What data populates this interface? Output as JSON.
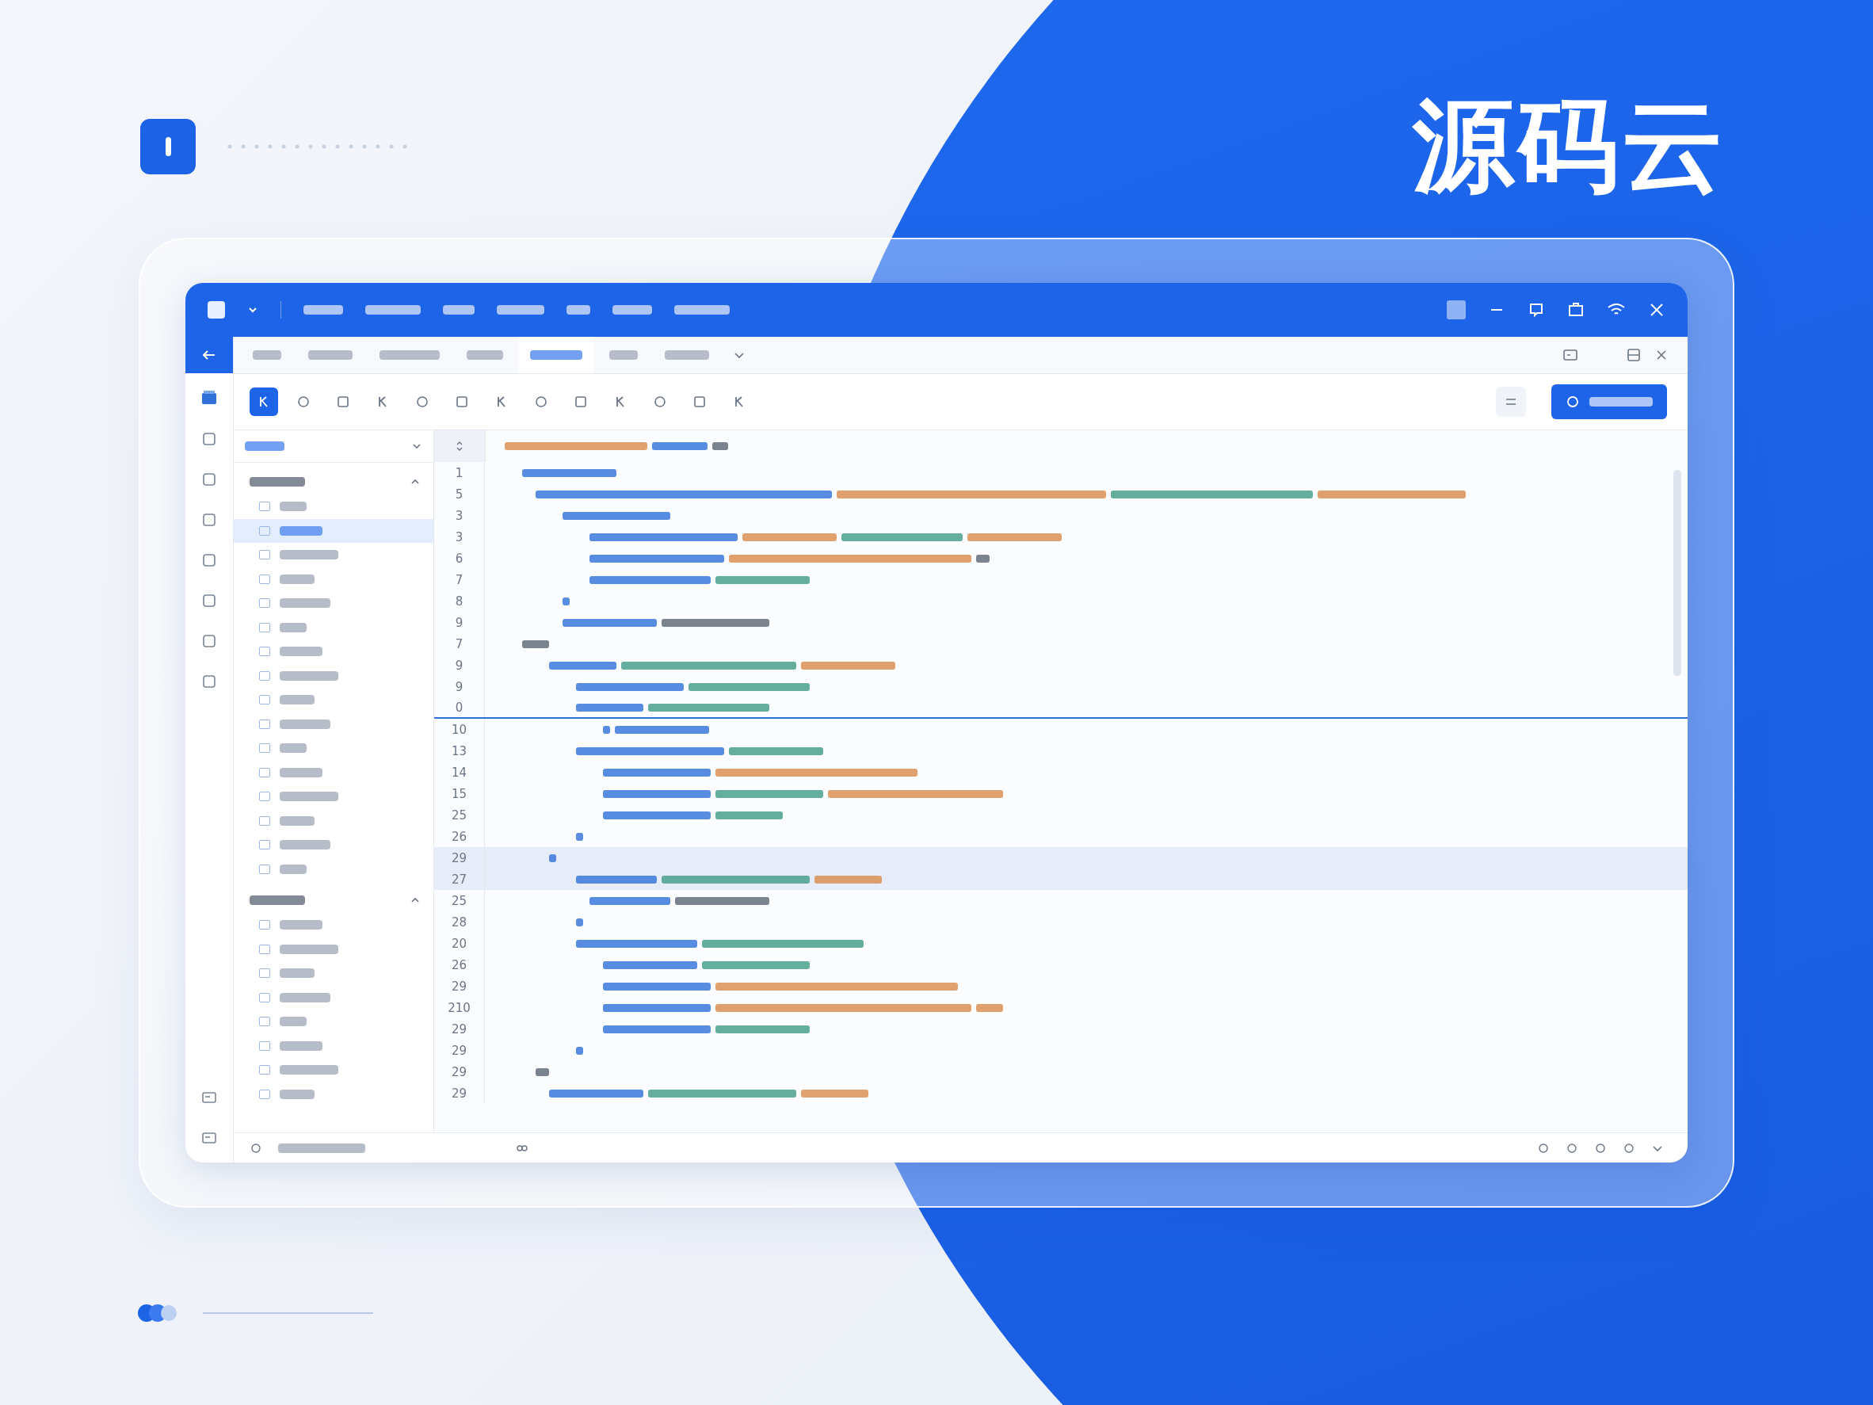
{
  "brand": {
    "title": "源码云"
  },
  "tabs": [
    {
      "selected": false
    },
    {
      "selected": false
    },
    {
      "selected": false
    },
    {
      "selected": false
    },
    {
      "selected": true
    },
    {
      "selected": false
    },
    {
      "selected": false
    }
  ],
  "toolbar": {
    "tools": [
      {
        "selected": true
      },
      {
        "selected": false
      },
      {
        "selected": false
      },
      {
        "selected": false
      },
      {
        "selected": false
      },
      {
        "selected": false
      },
      {
        "selected": false
      },
      {
        "selected": false
      },
      {
        "selected": false
      },
      {
        "selected": false
      },
      {
        "selected": false
      },
      {
        "selected": false
      },
      {
        "selected": false
      }
    ]
  },
  "tree": {
    "sections": [
      {
        "expanded": true,
        "children": [
          {
            "selected": false
          },
          {
            "selected": true
          },
          {
            "selected": false
          },
          {
            "selected": false
          },
          {
            "selected": false
          },
          {
            "selected": false
          },
          {
            "selected": false
          },
          {
            "selected": false
          },
          {
            "selected": false
          },
          {
            "selected": false
          },
          {
            "selected": false
          },
          {
            "selected": false
          },
          {
            "selected": false
          },
          {
            "selected": false
          },
          {
            "selected": false
          },
          {
            "selected": false
          }
        ]
      },
      {
        "expanded": true,
        "children": [
          {
            "selected": false
          },
          {
            "selected": false
          },
          {
            "selected": false
          },
          {
            "selected": false
          },
          {
            "selected": false
          },
          {
            "selected": false
          },
          {
            "selected": false
          },
          {
            "selected": false
          }
        ]
      }
    ]
  },
  "editor": {
    "lines": [
      {
        "number": "1",
        "highlighted": false,
        "current": false
      },
      {
        "number": "5",
        "highlighted": false,
        "current": false
      },
      {
        "number": "3",
        "highlighted": false,
        "current": false
      },
      {
        "number": "3",
        "highlighted": false,
        "current": false
      },
      {
        "number": "6",
        "highlighted": false,
        "current": false
      },
      {
        "number": "7",
        "highlighted": false,
        "current": false
      },
      {
        "number": "8",
        "highlighted": false,
        "current": false
      },
      {
        "number": "9",
        "highlighted": false,
        "current": false
      },
      {
        "number": "7",
        "highlighted": false,
        "current": false
      },
      {
        "number": "9",
        "highlighted": false,
        "current": false
      },
      {
        "number": "9",
        "highlighted": false,
        "current": false
      },
      {
        "number": "0",
        "highlighted": false,
        "current": true
      },
      {
        "number": "10",
        "highlighted": false,
        "current": false
      },
      {
        "number": "13",
        "highlighted": false,
        "current": false
      },
      {
        "number": "14",
        "highlighted": false,
        "current": false
      },
      {
        "number": "15",
        "highlighted": false,
        "current": false
      },
      {
        "number": "25",
        "highlighted": false,
        "current": false
      },
      {
        "number": "26",
        "highlighted": false,
        "current": false
      },
      {
        "number": "29",
        "highlighted": true,
        "current": false
      },
      {
        "number": "27",
        "highlighted": true,
        "current": false
      },
      {
        "number": "25",
        "highlighted": false,
        "current": false
      },
      {
        "number": "28",
        "highlighted": false,
        "current": false
      },
      {
        "number": "20",
        "highlighted": false,
        "current": false
      },
      {
        "number": "26",
        "highlighted": false,
        "current": false
      },
      {
        "number": "29",
        "highlighted": false,
        "current": false
      },
      {
        "number": "210",
        "highlighted": false,
        "current": false
      },
      {
        "number": "29",
        "highlighted": false,
        "current": false
      },
      {
        "number": "29",
        "highlighted": false,
        "current": false
      },
      {
        "number": "29",
        "highlighted": false,
        "current": false
      },
      {
        "number": "29",
        "highlighted": false,
        "current": false
      }
    ]
  }
}
